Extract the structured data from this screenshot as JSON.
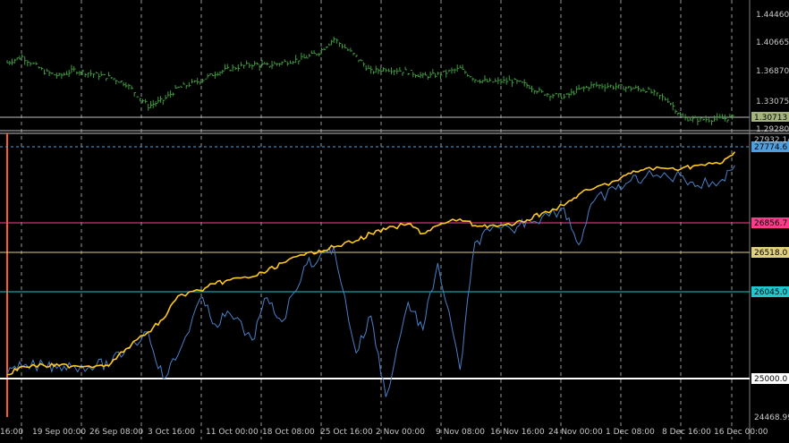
{
  "chart_data": [
    {
      "type": "candlestick",
      "name": "",
      "ylim": [
        1.2928,
        1.4446
      ],
      "y_ticks": [
        "1.44460",
        "1.40665",
        "1.36870",
        "1.33075",
        "1.29280"
      ],
      "current_price": 1.30713,
      "current_price_label": "1.30713",
      "colors": {
        "bars": "#3f9a3f",
        "price_line": "#c0c0c0",
        "badge": "#a4b47c"
      },
      "series": [
        {
          "x": [
            "2012-09-12",
            "2012-09-14",
            "2012-09-17",
            "2012-09-19",
            "2012-09-21",
            "2012-09-24",
            "2012-09-26",
            "2012-09-28",
            "2012-10-01",
            "2012-10-03",
            "2012-10-05",
            "2012-10-08",
            "2012-10-10",
            "2012-10-12",
            "2012-10-15",
            "2012-10-17",
            "2012-10-19",
            "2012-10-22",
            "2012-10-24",
            "2012-10-26",
            "2012-10-29",
            "2012-10-31",
            "2012-11-02",
            "2012-11-05",
            "2012-11-07",
            "2012-11-09",
            "2012-11-12",
            "2012-11-14",
            "2012-11-16",
            "2012-11-19",
            "2012-11-21",
            "2012-11-23",
            "2012-11-26",
            "2012-11-28",
            "2012-11-30",
            "2012-12-03",
            "2012-12-05",
            "2012-12-07",
            "2012-12-10",
            "2012-12-12",
            "2012-12-14",
            "2012-12-17",
            "2012-12-19"
          ],
          "values": [
            1.38,
            1.388,
            1.368,
            1.362,
            1.37,
            1.364,
            1.36,
            1.352,
            1.322,
            1.33,
            1.346,
            1.356,
            1.366,
            1.372,
            1.378,
            1.376,
            1.38,
            1.386,
            1.394,
            1.412,
            1.388,
            1.368,
            1.372,
            1.368,
            1.362,
            1.364,
            1.372,
            1.358,
            1.354,
            1.356,
            1.35,
            1.34,
            1.334,
            1.344,
            1.35,
            1.348,
            1.346,
            1.344,
            1.33,
            1.306,
            1.304,
            1.305,
            1.307
          ]
        }
      ]
    },
    {
      "type": "line",
      "name": "",
      "ylim": [
        24468.99,
        27932.14
      ],
      "y_ticks": [
        "27932.14",
        "24468.99"
      ],
      "horizontal_levels": [
        {
          "value": 27774.6,
          "label": "27774.6",
          "color": "#4f9fdf",
          "style": "dashed"
        },
        {
          "value": 26856.7,
          "label": "26856.7",
          "color": "#ff3c8c",
          "style": "solid"
        },
        {
          "value": 26518.0,
          "label": "26518.0",
          "color": "#e0d080",
          "style": "solid"
        },
        {
          "value": 26045.0,
          "label": "26045.0",
          "color": "#1fc8d0",
          "style": "solid"
        },
        {
          "value": 25000.0,
          "label": "25000.0",
          "color": "#ffffff",
          "style": "solid"
        }
      ],
      "series": [
        {
          "color": "#ffc81e",
          "x": [
            "2012-09-12",
            "2012-09-14",
            "2012-09-17",
            "2012-09-19",
            "2012-09-21",
            "2012-09-24",
            "2012-09-26",
            "2012-09-28",
            "2012-10-01",
            "2012-10-03",
            "2012-10-05",
            "2012-10-08",
            "2012-10-10",
            "2012-10-12",
            "2012-10-15",
            "2012-10-17",
            "2012-10-19",
            "2012-10-22",
            "2012-10-24",
            "2012-10-26",
            "2012-10-29",
            "2012-10-31",
            "2012-11-02",
            "2012-11-05",
            "2012-11-07",
            "2012-11-09",
            "2012-11-12",
            "2012-11-14",
            "2012-11-16",
            "2012-11-19",
            "2012-11-21",
            "2012-11-23",
            "2012-11-26",
            "2012-11-28",
            "2012-11-30",
            "2012-12-03",
            "2012-12-05",
            "2012-12-07",
            "2012-12-10",
            "2012-12-12",
            "2012-12-14",
            "2012-12-17",
            "2012-12-19"
          ],
          "values": [
            25000,
            25100,
            25110,
            25110,
            25110,
            25110,
            25140,
            25320,
            25530,
            25690,
            25980,
            26050,
            26130,
            26180,
            26220,
            26290,
            26390,
            26490,
            26550,
            26590,
            26670,
            26760,
            26810,
            26880,
            26760,
            26860,
            26940,
            26860,
            26860,
            26860,
            26930,
            27010,
            27110,
            27250,
            27320,
            27420,
            27510,
            27570,
            27570,
            27580,
            27610,
            27630,
            27780
          ]
        },
        {
          "color": "#4b7fc8",
          "x": [
            "2012-09-12",
            "2012-09-14",
            "2012-09-17",
            "2012-09-19",
            "2012-09-21",
            "2012-09-24",
            "2012-09-26",
            "2012-09-28",
            "2012-10-01",
            "2012-10-03",
            "2012-10-05",
            "2012-10-08",
            "2012-10-10",
            "2012-10-12",
            "2012-10-15",
            "2012-10-17",
            "2012-10-19",
            "2012-10-22",
            "2012-10-24",
            "2012-10-26",
            "2012-10-29",
            "2012-10-31",
            "2012-11-02",
            "2012-11-05",
            "2012-11-07",
            "2012-11-09",
            "2012-11-12",
            "2012-11-14",
            "2012-11-16",
            "2012-11-19",
            "2012-11-21",
            "2012-11-23",
            "2012-11-26",
            "2012-11-28",
            "2012-11-30",
            "2012-12-03",
            "2012-12-05",
            "2012-12-07",
            "2012-12-10",
            "2012-12-12",
            "2012-12-14",
            "2012-12-17",
            "2012-12-19"
          ],
          "values": [
            25000,
            25100,
            25110,
            25110,
            25110,
            25110,
            25140,
            25320,
            25530,
            24950,
            25240,
            25950,
            25630,
            25760,
            25430,
            25960,
            25660,
            26350,
            26450,
            26590,
            25270,
            25730,
            24720,
            25900,
            25560,
            26390,
            25060,
            26650,
            26790,
            26800,
            26930,
            26960,
            27080,
            26620,
            27160,
            27310,
            27420,
            27470,
            27470,
            27480,
            27360,
            27410,
            27610
          ]
        }
      ]
    }
  ],
  "x_axis_labels": [
    "16:00",
    "19 Sep 00:00",
    "26 Sep 08:00",
    "3 Oct 16:00",
    "11 Oct 00:00",
    "18 Oct 08:00",
    "25 Oct 16:00",
    "2 Nov 00:00",
    "9 Nov 08:00",
    "16 Nov 16:00",
    "24 Nov 00:00",
    "1 Dec 08:00",
    "8 Dec 16:00",
    "16 Dec 00:00"
  ],
  "colors": {
    "background": "#000000",
    "grid": "#c0c0c0",
    "separator": "#c0c0c0",
    "start_marker": "#ff5a1e"
  }
}
